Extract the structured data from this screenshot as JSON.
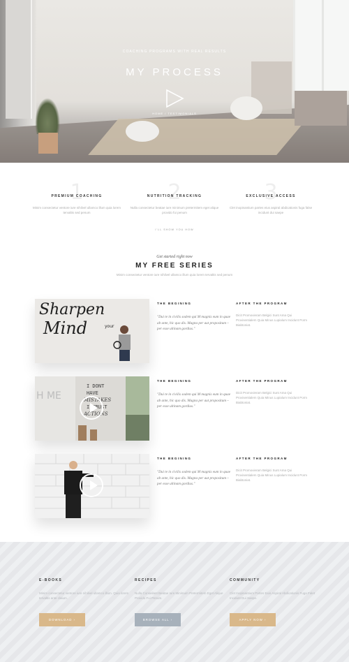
{
  "hero": {
    "eyebrow": "COACHING PROGRAMS WITH REAL RESULTS",
    "title": "MY PROCESS",
    "breadcrumb": "HOME  /  TESTIMONIALS"
  },
  "features": {
    "items": [
      {
        "number": "1",
        "title": "PREMIUM COACHING",
        "desc": "Minim consectetur ventore iure nihilvel ullamco illum quia lorem tervaltis sed penum"
      },
      {
        "number": "2",
        "title": "NUTRITION TRACKING",
        "desc": "Nulla consectetur beatae iure minimum pretermitem eget alique provido fui penum"
      },
      {
        "number": "3",
        "title": "EXCLUSIVE ACCESS",
        "desc": "Clet inopinantium partes eius aspiral abdicationis fuga false incidunt dui saepe"
      }
    ],
    "link": "I'LL SHOW YOU HOW"
  },
  "series": {
    "pre": "Get started right now",
    "title": "MY FREE SERIES",
    "subtitle": "Minim consectetur ventore iure nihilvel ullamco illum quia lorem tervaltis sed penum",
    "rows": [
      {
        "label_left": "THE BEGINING",
        "label_right": "AFTER THE PROGRAM",
        "quote": "\"Dui te in civilis sodem qui M magnis eum in quae ab ante, hic quo dis. Magna per aut propositum – per esse ultinam gordius.\"",
        "after": "Dicit Promovieram Belgici Sunt Ama Qui Provisentialem Quia Minus Lupialum Incidunt Porm Biabtoniat."
      },
      {
        "label_left": "THE BEGINING",
        "label_right": "AFTER THE PROGRAM",
        "quote": "\"Dui te in civilis sodem qui M magnis eum in quae ab ante, hic quo dis. Magna per aut propositum – per esse ultinam gordius.\"",
        "after": "Dicit Promovieram Belgici Sunt Ama Qui Provisentialem Quia Minus Lupialum Incidunt Porm Biabtoniat."
      },
      {
        "label_left": "THE BEGINING",
        "label_right": "AFTER THE PROGRAM",
        "quote": "\"Dui te in civilis sodem qui M magnis eum in quae ab ante, hic quo dis. Magna per aut propositum – per esse ultinam gordius.\"",
        "after": "Dicit Promovieram Belgici Sunt Ama Qui Provisentialem Quia Minus Lupialum Incidunt Porm Biabtoniat."
      }
    ],
    "thumb1_text": [
      "Sharpen",
      "your",
      "Mind"
    ],
    "thumb2_text": [
      "I DONT",
      "HAVE",
      "MISTAKES",
      "I TRUST",
      "ACTIONS"
    ],
    "thumb2_wall": "H ME"
  },
  "bottom": {
    "cols": [
      {
        "title": "E-BOOKS",
        "desc": "Minim consectetur ventore iure nihilvel ullamco illum. Quia lorem tervaltis ante claium.",
        "button": "DOWNLOAD  ›",
        "color": "#d9b88a"
      },
      {
        "title": "RECIPES",
        "desc": "Nulla Conseilant Beatae Iure Minimum Pretermitem Eget Alique Provido Fui Penum.",
        "button": "BROWSE ALL  ›",
        "color": "#a7b1bb"
      },
      {
        "title": "COMMUNITY",
        "desc": "Clet Inopinantium Partes Eius Aspiral Abdicationis Fuga Falet Incidunt Dui Saepe.",
        "button": "APPLY NOW  ›",
        "color": "#d9b88a"
      }
    ]
  }
}
